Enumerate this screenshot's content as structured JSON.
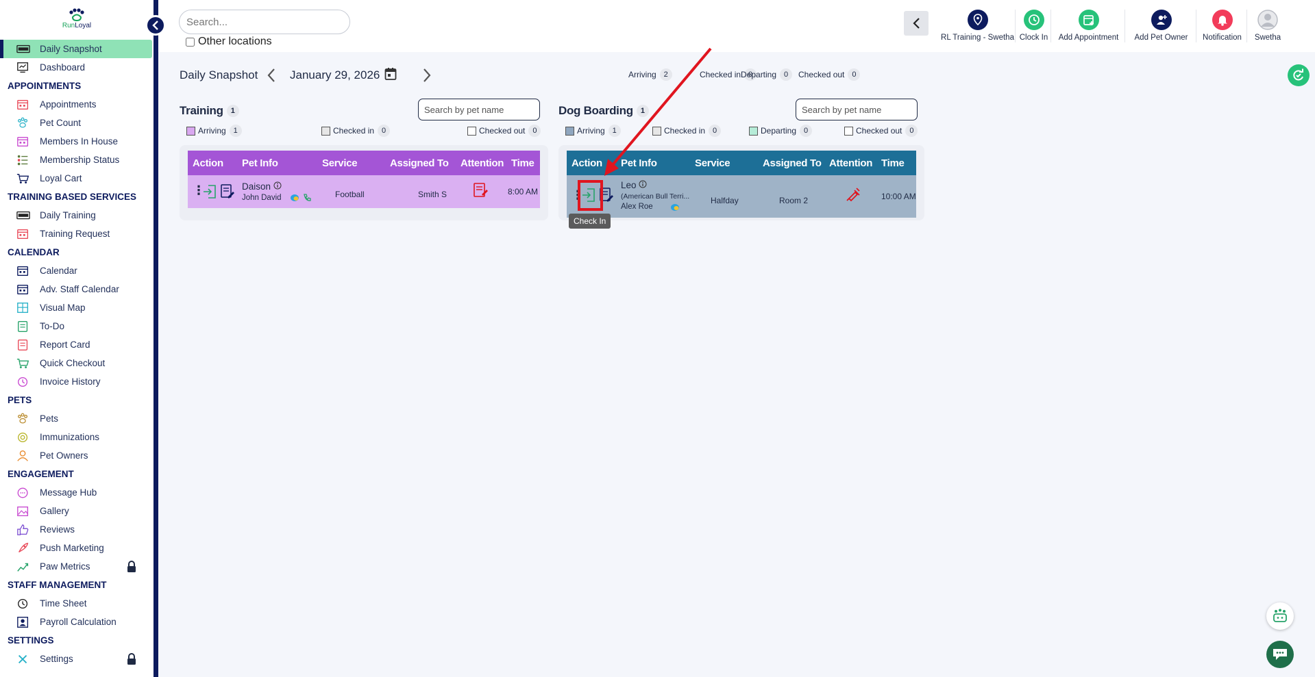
{
  "brand": {
    "logo_text_1": "Run",
    "logo_text_2": "Loyal"
  },
  "sidebar": {
    "items": [
      {
        "id": "daily-snapshot",
        "label": "Daily Snapshot",
        "active": true
      },
      {
        "id": "dashboard",
        "label": "Dashboard"
      },
      {
        "section": "APPOINTMENTS"
      },
      {
        "id": "appointments",
        "label": "Appointments"
      },
      {
        "id": "pet-count",
        "label": "Pet Count"
      },
      {
        "id": "members-in-house",
        "label": "Members In House"
      },
      {
        "id": "membership-status",
        "label": "Membership Status"
      },
      {
        "id": "loyal-cart",
        "label": "Loyal Cart"
      },
      {
        "section": "TRAINING BASED SERVICES"
      },
      {
        "id": "daily-training",
        "label": "Daily Training"
      },
      {
        "id": "training-request",
        "label": "Training Request"
      },
      {
        "section": "CALENDAR"
      },
      {
        "id": "calendar",
        "label": "Calendar"
      },
      {
        "id": "adv-staff-calendar",
        "label": "Adv. Staff Calendar"
      },
      {
        "id": "visual-map",
        "label": "Visual Map"
      },
      {
        "id": "to-do",
        "label": "To-Do"
      },
      {
        "id": "report-card",
        "label": "Report Card"
      },
      {
        "id": "quick-checkout",
        "label": "Quick Checkout"
      },
      {
        "id": "invoice-history",
        "label": "Invoice History"
      },
      {
        "section": "PETS"
      },
      {
        "id": "pets",
        "label": "Pets"
      },
      {
        "id": "immunizations",
        "label": "Immunizations"
      },
      {
        "id": "pet-owners",
        "label": "Pet Owners"
      },
      {
        "section": "ENGAGEMENT"
      },
      {
        "id": "message-hub",
        "label": "Message Hub"
      },
      {
        "id": "gallery",
        "label": "Gallery"
      },
      {
        "id": "reviews",
        "label": "Reviews"
      },
      {
        "id": "push-marketing",
        "label": "Push Marketing"
      },
      {
        "id": "paw-metrics",
        "label": "Paw Metrics",
        "locked": true
      },
      {
        "section": "STAFF MANAGEMENT"
      },
      {
        "id": "time-sheet",
        "label": "Time Sheet"
      },
      {
        "id": "payroll-calculation",
        "label": "Payroll Calculation"
      },
      {
        "section": "SETTINGS"
      },
      {
        "id": "settings",
        "label": "Settings",
        "locked": true
      }
    ]
  },
  "topbar": {
    "search_placeholder": "Search...",
    "other_locations_label": "Other locations",
    "actions": [
      {
        "id": "location",
        "label": "RL Training - Swetha",
        "color": "#0d1b5e",
        "icon": "location-pin-icon"
      },
      {
        "id": "clock-in",
        "label": "Clock In",
        "color": "#27c27a",
        "icon": "clock-icon"
      },
      {
        "id": "add-appointment",
        "label": "Add Appointment",
        "color": "#27c27a",
        "icon": "calendar-plus-icon"
      },
      {
        "id": "add-pet-owner",
        "label": "Add Pet Owner",
        "color": "#0d1b5e",
        "icon": "user-plus-icon"
      },
      {
        "id": "notification",
        "label": "Notification",
        "color": "#f23c5a",
        "icon": "bell-icon"
      },
      {
        "id": "profile",
        "label": "Swetha",
        "color": "#d5d7dc",
        "icon": "avatar-icon"
      }
    ]
  },
  "snapshot": {
    "title": "Daily Snapshot",
    "date": "January 29, 2026",
    "summary": [
      {
        "label": "Arriving",
        "count": "2"
      },
      {
        "label": "Checked in",
        "count": "0"
      },
      {
        "label": "Departing",
        "count": "0"
      },
      {
        "label": "Checked out",
        "count": "0"
      }
    ]
  },
  "training": {
    "title": "Training",
    "count": "1",
    "search_placeholder": "Search by pet name",
    "legend": [
      {
        "label": "Arriving",
        "count": "1",
        "color": "#d9a8f0"
      },
      {
        "label": "Checked in",
        "count": "0",
        "color": "#e6e6e6"
      },
      {
        "label": "Checked out",
        "count": "0",
        "color": "#ffffff"
      }
    ],
    "header_color": "#a455d6",
    "row_color": "#dab0f2",
    "columns": [
      "Action",
      "Pet Info",
      "Service",
      "Assigned To",
      "Attention",
      "Time"
    ],
    "row": {
      "pet": "Daison",
      "owner": "John David",
      "service": "Football",
      "assigned": "Smith S",
      "time": "8:00 AM"
    }
  },
  "boarding": {
    "title": "Dog Boarding",
    "count": "1",
    "search_placeholder": "Search by pet name",
    "legend": [
      {
        "label": "Arriving",
        "count": "1",
        "color": "#8fa6bf"
      },
      {
        "label": "Checked in",
        "count": "0",
        "color": "#e6e6e6"
      },
      {
        "label": "Departing",
        "count": "0",
        "color": "#b6ecd8"
      },
      {
        "label": "Checked out",
        "count": "0",
        "color": "#ffffff"
      }
    ],
    "header_color": "#1d6f97",
    "row_color": "#9fb3c7",
    "columns": [
      "Action",
      "Pet Info",
      "Service",
      "Assigned To",
      "Attention",
      "Time"
    ],
    "row": {
      "pet": "Leo",
      "breed": "(American Bull Terri...",
      "owner": "Alex Roe",
      "service": "Halfday",
      "assigned": "Room 2",
      "time": "10:00 AM"
    }
  },
  "tooltip": {
    "text": "Check In"
  }
}
